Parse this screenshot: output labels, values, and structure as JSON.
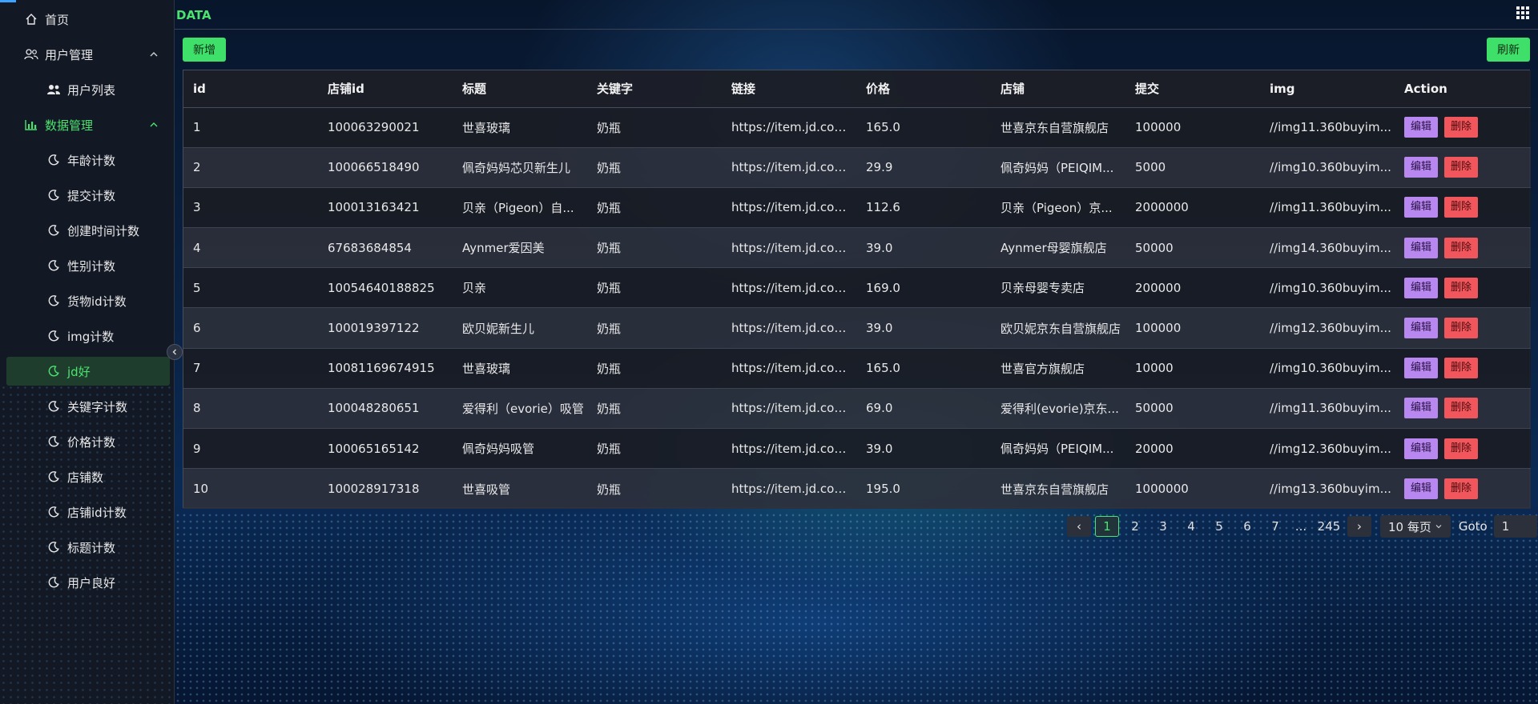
{
  "header": {
    "brand": "DATA"
  },
  "sidebar": {
    "home": "首页",
    "user_mgmt": "用户管理",
    "user_list": "用户列表",
    "data_mgmt": "数据管理",
    "items": [
      "年龄计数",
      "提交计数",
      "创建时间计数",
      "性别计数",
      "货物id计数",
      "img计数",
      "jd好",
      "关键字计数",
      "价格计数",
      "店铺数",
      "店铺id计数",
      "标题计数",
      "用户良好"
    ],
    "active_index": 6
  },
  "toolbar": {
    "add_label": "新增",
    "refresh_label": "刷新"
  },
  "table": {
    "columns": [
      "id",
      "店铺id",
      "标题",
      "关键字",
      "链接",
      "价格",
      "店铺",
      "提交",
      "img",
      "Action"
    ],
    "rows": [
      [
        "1",
        "100063290021",
        "世喜玻璃",
        "奶瓶",
        "https://item.jd.com...",
        "165.0",
        "世喜京东自营旗舰店",
        "100000",
        "//img11.360buyim..."
      ],
      [
        "2",
        "100066518490",
        "佩奇妈妈芯贝新生儿",
        "奶瓶",
        "https://item.jd.com...",
        "29.9",
        "佩奇妈妈（PEIQIM...",
        "5000",
        "//img10.360buyim..."
      ],
      [
        "3",
        "100013163421",
        "贝亲（Pigeon）自...",
        "奶瓶",
        "https://item.jd.com...",
        "112.6",
        "贝亲（Pigeon）京...",
        "2000000",
        "//img11.360buyim..."
      ],
      [
        "4",
        "67683684854",
        "Aynmer爱因美",
        "奶瓶",
        "https://item.jd.com...",
        "39.0",
        "Aynmer母婴旗舰店",
        "50000",
        "//img14.360buyim..."
      ],
      [
        "5",
        "10054640188825",
        "贝亲",
        "奶瓶",
        "https://item.jd.com...",
        "169.0",
        "贝亲母婴专卖店",
        "200000",
        "//img10.360buyim..."
      ],
      [
        "6",
        "100019397122",
        "欧贝妮新生儿",
        "奶瓶",
        "https://item.jd.com...",
        "39.0",
        "欧贝妮京东自营旗舰店",
        "100000",
        "//img12.360buyim..."
      ],
      [
        "7",
        "10081169674915",
        "世喜玻璃",
        "奶瓶",
        "https://item.jd.com...",
        "165.0",
        "世喜官方旗舰店",
        "10000",
        "//img10.360buyim..."
      ],
      [
        "8",
        "100048280651",
        "爱得利（evorie）吸管",
        "奶瓶",
        "https://item.jd.com...",
        "69.0",
        "爱得利(evorie)京东...",
        "50000",
        "//img11.360buyim..."
      ],
      [
        "9",
        "100065165142",
        "佩奇妈妈吸管",
        "奶瓶",
        "https://item.jd.com...",
        "39.0",
        "佩奇妈妈（PEIQIM...",
        "20000",
        "//img12.360buyim..."
      ],
      [
        "10",
        "100028917318",
        "世喜吸管",
        "奶瓶",
        "https://item.jd.com...",
        "195.0",
        "世喜京东自营旗舰店",
        "1000000",
        "//img13.360buyim..."
      ]
    ],
    "edit_label": "编辑",
    "delete_label": "删除"
  },
  "pagination": {
    "prev": "‹",
    "next": "›",
    "pages": [
      "1",
      "2",
      "3",
      "4",
      "5",
      "6",
      "7",
      "...",
      "245"
    ],
    "current": "1",
    "page_size": "10 每页",
    "goto_label": "Goto",
    "goto_value": "1"
  },
  "colors": {
    "accent_green": "#3fe06a",
    "edit_purple": "#b987f0",
    "delete_red": "#f0565b"
  }
}
